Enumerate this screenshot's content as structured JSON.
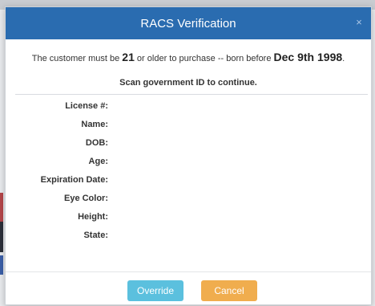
{
  "modal": {
    "title": "RACS Verification",
    "close_symbol": "×",
    "notice": {
      "prefix": "The customer must be ",
      "age": "21",
      "middle": " or older to purchase -- born before ",
      "date": "Dec 9th 1998",
      "suffix": "."
    },
    "scan_message": "Scan government ID to continue.",
    "fields": [
      {
        "label": "License #:",
        "value": ""
      },
      {
        "label": "Name:",
        "value": ""
      },
      {
        "label": "DOB:",
        "value": ""
      },
      {
        "label": "Age:",
        "value": ""
      },
      {
        "label": "Expiration Date:",
        "value": ""
      },
      {
        "label": "Eye Color:",
        "value": ""
      },
      {
        "label": "Height:",
        "value": ""
      },
      {
        "label": "State:",
        "value": ""
      }
    ],
    "buttons": {
      "override": "Override",
      "cancel": "Cancel"
    }
  },
  "colors": {
    "header": "#2a6cb0",
    "override": "#5bc0de",
    "cancel": "#f0ad4e"
  },
  "icons": {
    "close": "close-icon"
  }
}
